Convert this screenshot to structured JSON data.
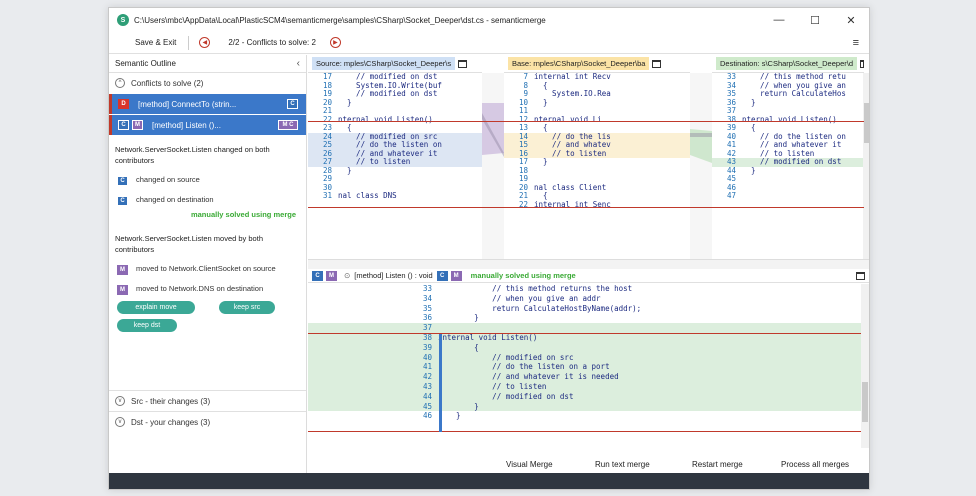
{
  "window": {
    "title": "C:\\Users\\mbc\\AppData\\Local\\PlasticSCM4\\semanticmerge\\samples\\CSharp\\Socket_Deeper\\dst.cs - semanticmerge",
    "minimize": "—",
    "maximize": "☐",
    "close": "✕"
  },
  "toolbar": {
    "save_exit": "Save & Exit",
    "conflict_count": "2/2 -  Conflicts to solve: 2",
    "prev_glyph": "◀",
    "next_glyph": "▶",
    "menu_glyph": "≡"
  },
  "sidebar": {
    "title": "Semantic Outline",
    "collapse_glyph": "‹",
    "conflicts_header": "Conflicts to solve (2)",
    "items": [
      {
        "badges": [
          "D"
        ],
        "label": "[method] ConnectTo (strin...",
        "end_badge": "C"
      },
      {
        "badges": [
          "C",
          "M"
        ],
        "label": "[method] Listen ()...",
        "end_badge": "M C"
      }
    ],
    "detail1": {
      "title": "Network.ServerSocket.Listen changed on both contributors",
      "rows": [
        {
          "badge": "C",
          "text": "changed on source"
        },
        {
          "badge": "C",
          "text": "changed on destination"
        }
      ],
      "solved": "manually solved using merge"
    },
    "detail2": {
      "title": "Network.ServerSocket.Listen  moved by both contributors",
      "rows": [
        {
          "badge": "M",
          "text": "moved to Network.ClientSocket on source"
        },
        {
          "badge": "M",
          "text": "moved to Network.DNS on destination"
        }
      ],
      "buttons": [
        "explain move",
        "keep src",
        "keep dst"
      ]
    },
    "src_header": "Src - their changes (3)",
    "dst_header": "Dst - your changes (3)"
  },
  "panes": {
    "source": {
      "header": "Source: mples\\CSharp\\Socket_Deeper\\s",
      "lines": [
        {
          "n": "17",
          "t": "    // modified on dst"
        },
        {
          "n": "18",
          "t": "    System.IO.Write(buf"
        },
        {
          "n": "19",
          "t": "    // modified on dst"
        },
        {
          "n": "20",
          "t": "  }"
        },
        {
          "n": "21",
          "t": ""
        },
        {
          "n": "22",
          "t": "nternal void Listen()"
        },
        {
          "n": "23",
          "t": "  {"
        },
        {
          "n": "24",
          "t": "    // modified on src"
        },
        {
          "n": "25",
          "t": "    // do the listen on"
        },
        {
          "n": "26",
          "t": "    // and whatever it"
        },
        {
          "n": "27",
          "t": "    // to listen"
        },
        {
          "n": "28",
          "t": "  }"
        },
        {
          "n": "29",
          "t": ""
        },
        {
          "n": "30",
          "t": ""
        },
        {
          "n": "31",
          "t": "nal class DNS"
        }
      ]
    },
    "base": {
      "header": "Base: rnples\\CSharp\\Socket_Deeper\\ba",
      "lines": [
        {
          "n": "7",
          "t": "internal int Recv"
        },
        {
          "n": "8",
          "t": "  {"
        },
        {
          "n": "9",
          "t": "    System.IO.Rea"
        },
        {
          "n": "10",
          "t": "  }"
        },
        {
          "n": "11",
          "t": ""
        },
        {
          "n": "12",
          "t": "nternal void Li"
        },
        {
          "n": "13",
          "t": "  {"
        },
        {
          "n": "14",
          "t": "    // do the lis"
        },
        {
          "n": "15",
          "t": "    // and whatev"
        },
        {
          "n": "16",
          "t": "    // to listen"
        },
        {
          "n": "17",
          "t": "  }"
        },
        {
          "n": "18",
          "t": ""
        },
        {
          "n": "19",
          "t": ""
        },
        {
          "n": "20",
          "t": "nal class Client"
        },
        {
          "n": "21",
          "t": "  {"
        },
        {
          "n": "22",
          "t": "internal int Senc"
        }
      ]
    },
    "destination": {
      "header": "Destination: s\\CSharp\\Socket_Deeper\\d",
      "lines": [
        {
          "n": "33",
          "t": "    // this method retu"
        },
        {
          "n": "34",
          "t": "    // when you give an"
        },
        {
          "n": "35",
          "t": "    return CalculateHos"
        },
        {
          "n": "36",
          "t": "  }"
        },
        {
          "n": "37",
          "t": ""
        },
        {
          "n": "38",
          "t": "nternal void Listen()"
        },
        {
          "n": "39",
          "t": "  {"
        },
        {
          "n": "40",
          "t": "    // do the listen on"
        },
        {
          "n": "41",
          "t": "    // and whatever it"
        },
        {
          "n": "42",
          "t": "    // to listen"
        },
        {
          "n": "43",
          "t": "    // modified on dst"
        },
        {
          "n": "44",
          "t": "  }"
        },
        {
          "n": "45",
          "t": ""
        },
        {
          "n": "46",
          "t": ""
        },
        {
          "n": "47",
          "t": ""
        }
      ]
    }
  },
  "result": {
    "header_label": "[method] Listen () : void",
    "header_solved": "manually solved using merge",
    "lines": [
      {
        "n": "33",
        "t": "            // this method returns the host"
      },
      {
        "n": "34",
        "t": "            // when you give an addr"
      },
      {
        "n": "35",
        "t": "            return CalculateHostByName(addr);"
      },
      {
        "n": "36",
        "t": "        }"
      },
      {
        "n": "37",
        "t": ""
      },
      {
        "n": "38",
        "t": "internal void Listen()"
      },
      {
        "n": "39",
        "t": "        {"
      },
      {
        "n": "40",
        "t": "            // modified on src"
      },
      {
        "n": "41",
        "t": "            // do the listen on a port"
      },
      {
        "n": "42",
        "t": "            // and whatever it is needed"
      },
      {
        "n": "43",
        "t": "            // to listen"
      },
      {
        "n": "44",
        "t": "            // modified on dst"
      },
      {
        "n": "45",
        "t": "        }"
      },
      {
        "n": "46",
        "t": "    }"
      }
    ]
  },
  "footer": {
    "visual_merge": "Visual Merge",
    "run_text_merge": "Run text merge",
    "restart_merge": "Restart merge",
    "process_all": "Process all merges"
  }
}
